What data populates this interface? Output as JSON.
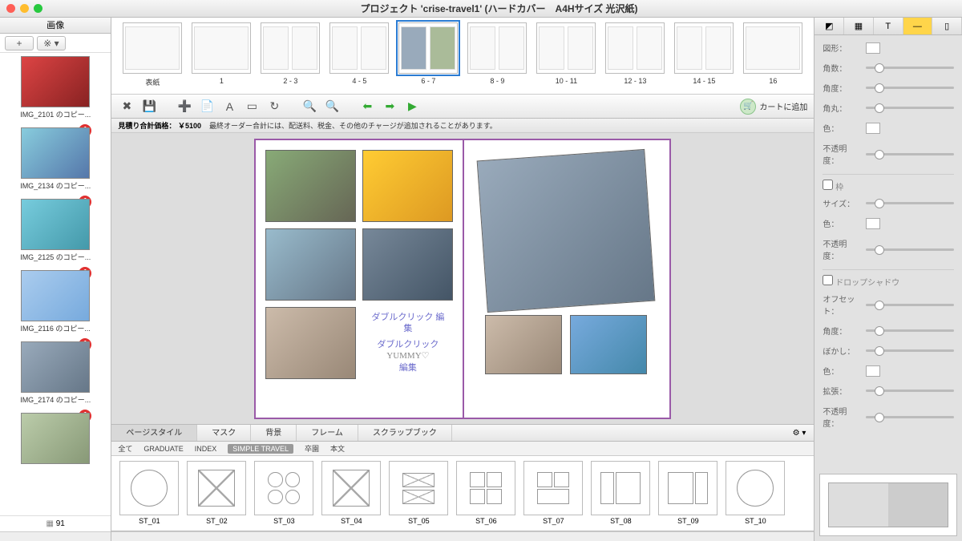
{
  "window": {
    "title": "プロジェクト 'crise-travel1' (ハードカバー　A4Hサイズ 光沢紙)"
  },
  "sidebar_left": {
    "header": "画像",
    "add_label": "+",
    "gear_label": "※ ▾",
    "count": "91",
    "items": [
      {
        "label": "IMG_2101 のコピー...",
        "badge": ""
      },
      {
        "label": "IMG_2134 のコピー...",
        "badge": "1"
      },
      {
        "label": "IMG_2125 のコピー...",
        "badge": "1"
      },
      {
        "label": "IMG_2116 のコピー...",
        "badge": "1"
      },
      {
        "label": "IMG_2174 のコピー...",
        "badge": "1"
      },
      {
        "label": "",
        "badge": "1"
      }
    ]
  },
  "pages": {
    "items": [
      {
        "label": "表紙"
      },
      {
        "label": "1"
      },
      {
        "label": "2 - 3"
      },
      {
        "label": "4 - 5"
      },
      {
        "label": "6 - 7",
        "selected": true
      },
      {
        "label": "8 - 9"
      },
      {
        "label": "10 - 11"
      },
      {
        "label": "12 - 13"
      },
      {
        "label": "14 - 15"
      },
      {
        "label": "16"
      }
    ]
  },
  "toolbar": {
    "cart_label": "カートに追加"
  },
  "pricebar": {
    "label": "見積り合計価格：",
    "price": "￥5100",
    "note": "最終オーダー合計には、配送料、税金、その他のチャージが追加されることがあります。"
  },
  "canvas": {
    "txt1": "ダブルクリック 編集",
    "txt2": "ダブルクリック",
    "txt3": "編集",
    "txt4": "YUMMY♡"
  },
  "bottom_tabs": {
    "items": [
      "ページスタイル",
      "マスク",
      "背景",
      "フレーム",
      "スクラップブック"
    ],
    "active": 0
  },
  "categories": {
    "items": [
      "全て",
      "GRADUATE",
      "INDEX",
      "SIMPLE TRAVEL",
      "卒園",
      "本文"
    ],
    "selected": 3
  },
  "styles": {
    "items": [
      "ST_01",
      "ST_02",
      "ST_03",
      "ST_04",
      "ST_05",
      "ST_06",
      "ST_07",
      "ST_08",
      "ST_09",
      "ST_10"
    ]
  },
  "props": {
    "section1": [
      "図形：",
      "角数：",
      "角度：",
      "角丸：",
      "色：",
      "不透明度："
    ],
    "section2_title": "枠",
    "section2": [
      "サイズ：",
      "色：",
      "不透明度："
    ],
    "section3_title": "ドロップシャドウ",
    "section3": [
      "オフセット：",
      "角度：",
      "ぼかし：",
      "色：",
      "拡張：",
      "不透明度："
    ]
  }
}
